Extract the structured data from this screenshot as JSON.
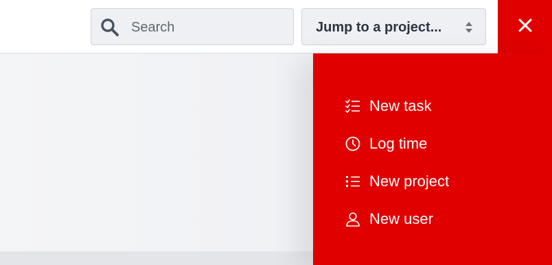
{
  "header": {
    "search": {
      "placeholder": "Search",
      "value": "",
      "icon": "search-icon"
    },
    "project_jump": {
      "label": "Jump to a project...",
      "icon": "sort-arrows-icon"
    },
    "close": {
      "icon": "close-icon"
    }
  },
  "quick_menu": {
    "background": "#e00000",
    "items": [
      {
        "label": "New task",
        "icon": "checklist-icon"
      },
      {
        "label": "Log time",
        "icon": "clock-icon"
      },
      {
        "label": "New project",
        "icon": "list-icon"
      },
      {
        "label": "New user",
        "icon": "user-icon"
      }
    ]
  }
}
